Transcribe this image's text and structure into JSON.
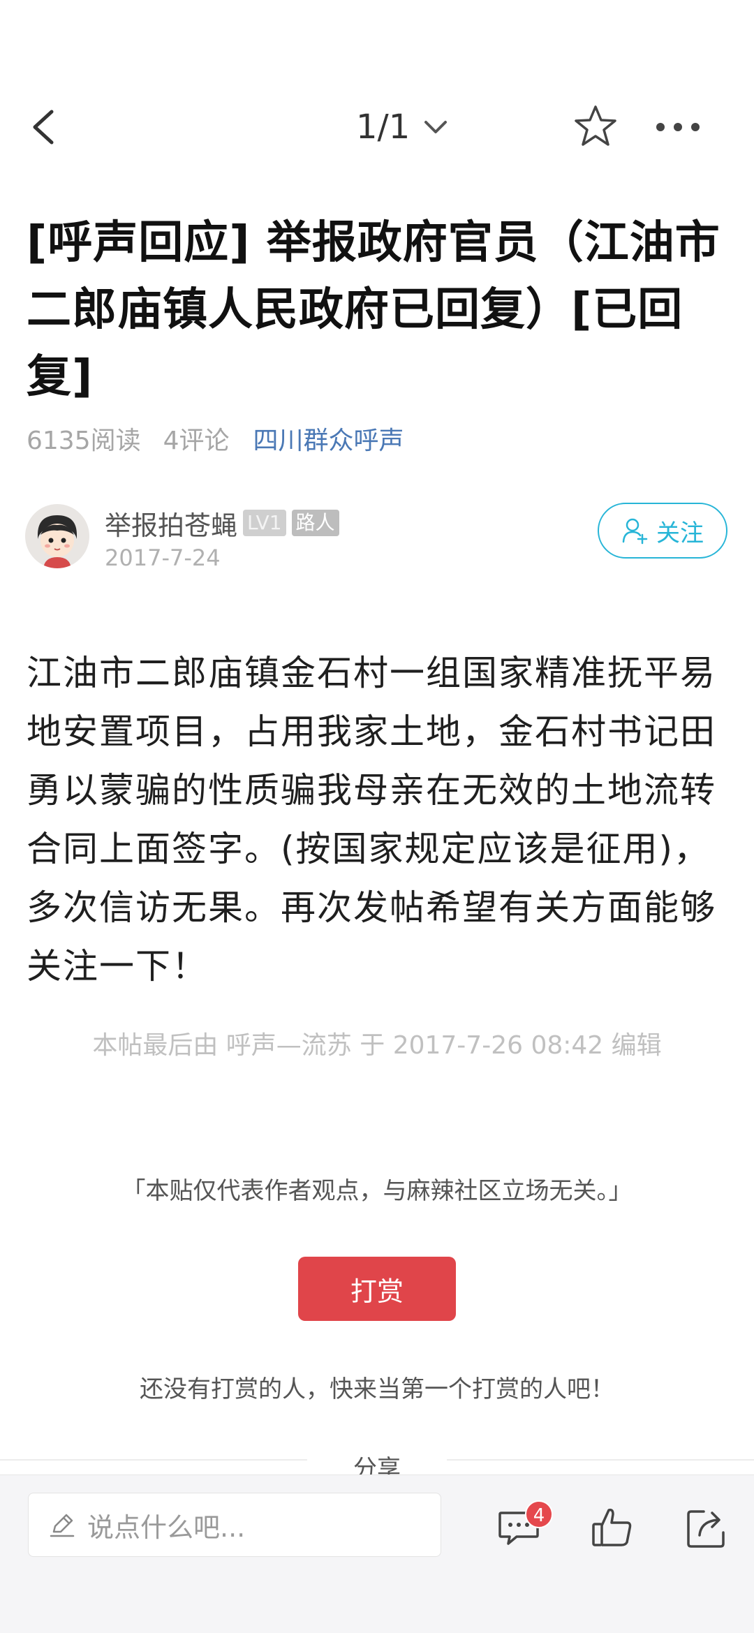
{
  "nav": {
    "page_indicator": "1/1"
  },
  "post": {
    "title": "[呼声回应] 举报政府官员（江油市二郎庙镇人民政府已回复）[已回复]",
    "reads": "6135阅读",
    "comments": "4评论",
    "forum": "四川群众呼声",
    "author": {
      "name": "举报拍苍蝇",
      "level_badge": "LV1",
      "role_badge": "路人",
      "date": "2017-7-24",
      "follow_label": "关注"
    },
    "body": "江油市二郎庙镇金石村一组国家精准抚平易地安置项目，占用我家土地，金石村书记田勇以蒙骗的性质骗我母亲在无效的土地流转合同上面签字。(按国家规定应该是征用)，多次信访无果。再次发帖希望有关方面能够关注一下！",
    "edit_note": "本帖最后由 呼声—流苏 于 2017-7-26 08:42 编辑",
    "disclaimer": "「本贴仅代表作者观点，与麻辣社区立场无关。」",
    "reward_label": "打赏",
    "reward_note": "还没有打赏的人，快来当第一个打赏的人吧！",
    "share_label": "分享"
  },
  "bottom_bar": {
    "comment_placeholder": "说点什么吧...",
    "comment_count": "4"
  },
  "colors": {
    "accent": "#27b5d7",
    "forum_link": "#4a78b5",
    "reward": "#e0454a",
    "badge_red": "#e5484d"
  }
}
